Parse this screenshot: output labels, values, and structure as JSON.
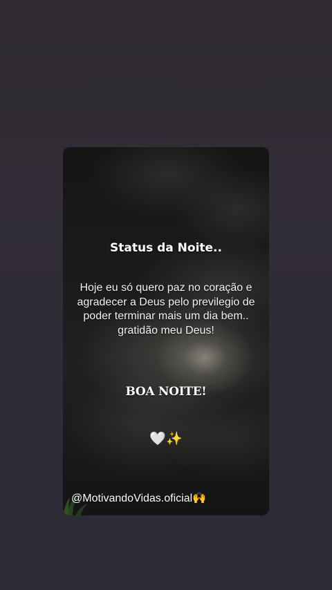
{
  "story": {
    "title": "Status da Noite..",
    "message": "Hoje eu só quero paz no coração e agradecer a Deus pelo previlegio de poder terminar mais um dia bem.. gratidão meu Deus!",
    "greeting": "BOA NOITE!",
    "emojis": {
      "heart": "🤍",
      "sparkles": "✨"
    },
    "handle": {
      "text": "@MotivandoVidas.oficial",
      "emoji": "🙌"
    }
  },
  "colors": {
    "page_background": "#302c36",
    "card_background": "#1a1a1a",
    "text": "#ffffff"
  },
  "icons": [
    "white-heart-icon",
    "sparkles-icon",
    "raising-hands-icon"
  ]
}
